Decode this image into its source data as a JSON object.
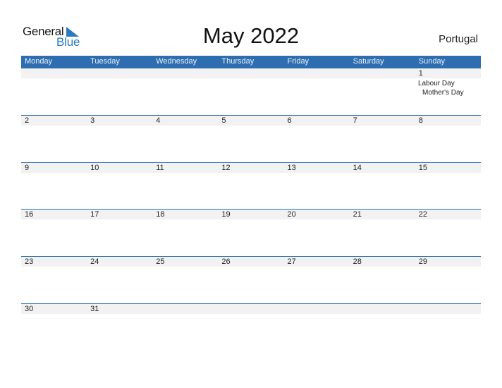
{
  "brand": {
    "word1": "General",
    "word2": "Blue",
    "accent": "#2a7bc1"
  },
  "title": "May 2022",
  "country": "Portugal",
  "colors": {
    "header_bg": "#2e6eb0",
    "number_row_bg": "#f2f2f2"
  },
  "weekdays": [
    "Monday",
    "Tuesday",
    "Wednesday",
    "Thursday",
    "Friday",
    "Saturday",
    "Sunday"
  ],
  "weeks": [
    [
      "",
      "",
      "",
      "",
      "",
      "",
      "1"
    ],
    [
      "2",
      "3",
      "4",
      "5",
      "6",
      "7",
      "8"
    ],
    [
      "9",
      "10",
      "11",
      "12",
      "13",
      "14",
      "15"
    ],
    [
      "16",
      "17",
      "18",
      "19",
      "20",
      "21",
      "22"
    ],
    [
      "23",
      "24",
      "25",
      "26",
      "27",
      "28",
      "29"
    ],
    [
      "30",
      "31",
      "",
      "",
      "",
      "",
      ""
    ]
  ],
  "holidays": {
    "day1": [
      "Labour Day",
      "Mother's Day"
    ]
  }
}
